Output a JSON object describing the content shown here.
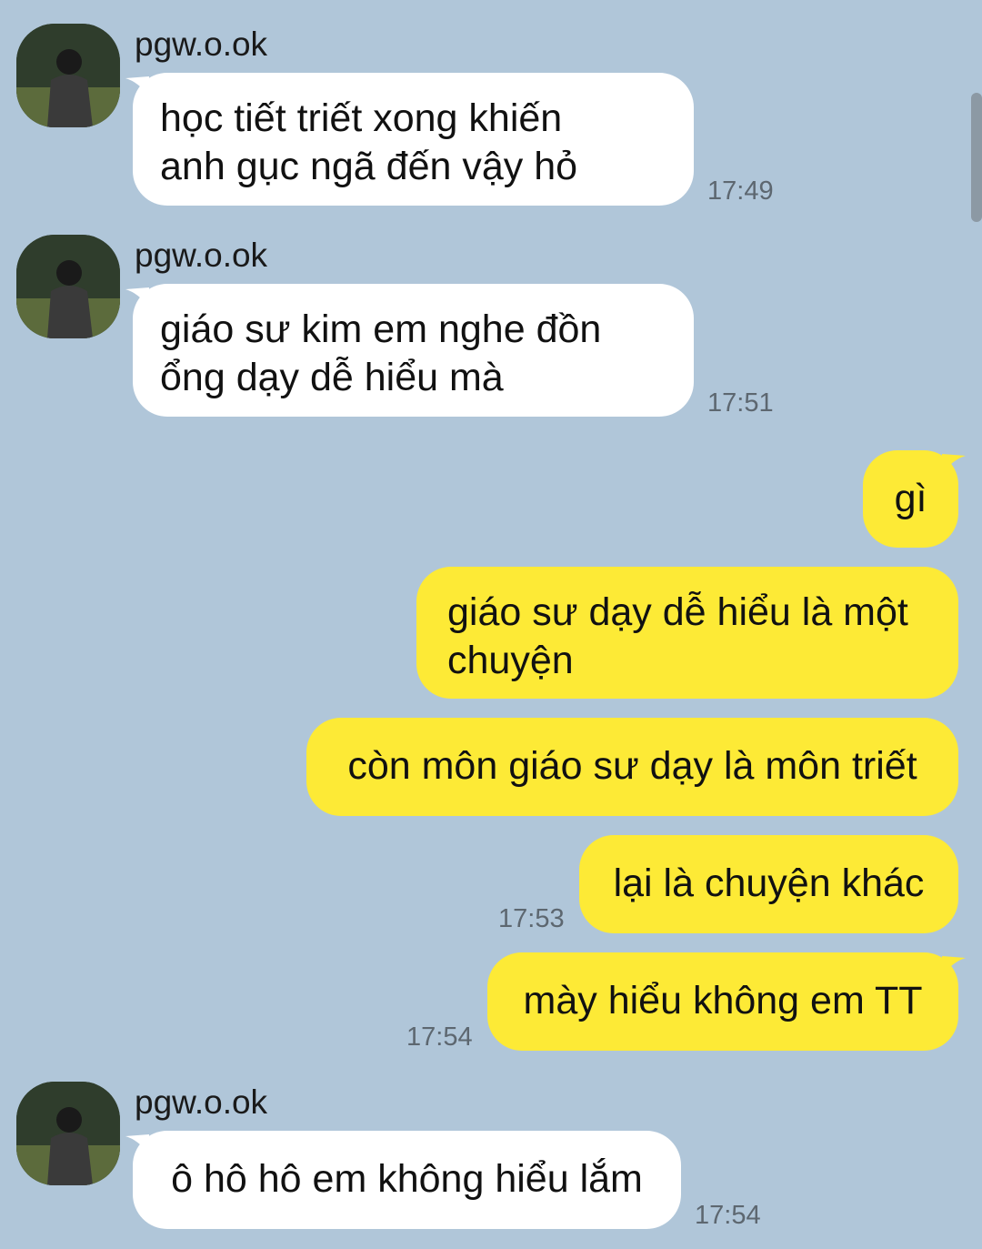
{
  "messages": [
    {
      "sender": "pgw.o.ok",
      "text": "học tiết triết xong khiến anh gục ngã đến vậy hỏ",
      "lines": [
        "học tiết triết xong khiến",
        "anh gục ngã đến vậy hỏ"
      ],
      "time": "17:49"
    },
    {
      "sender": "pgw.o.ok",
      "text": "giáo sư kim em nghe đồn ổng dạy dễ hiểu mà",
      "lines": [
        "giáo sư kim em nghe đồn",
        "ổng dạy dễ hiểu mà"
      ],
      "time": "17:51"
    },
    {
      "text": "gì"
    },
    {
      "text": "giáo sư dạy dễ hiểu là một chuyện",
      "lines": [
        "giáo sư dạy dễ hiểu là một",
        "chuyện"
      ]
    },
    {
      "text": "còn môn giáo sư dạy là môn triết"
    },
    {
      "text": "lại là chuyện khác",
      "time": "17:53"
    },
    {
      "text": "mày hiểu không em TT",
      "time": "17:54"
    },
    {
      "sender": "pgw.o.ok",
      "text": "ô hô hô em không hiểu lắm",
      "time": "17:54"
    }
  ],
  "colors": {
    "background": "#b0c6d9",
    "incoming_bubble": "#ffffff",
    "outgoing_bubble": "#fdea36",
    "timestamp": "#5d6770"
  }
}
